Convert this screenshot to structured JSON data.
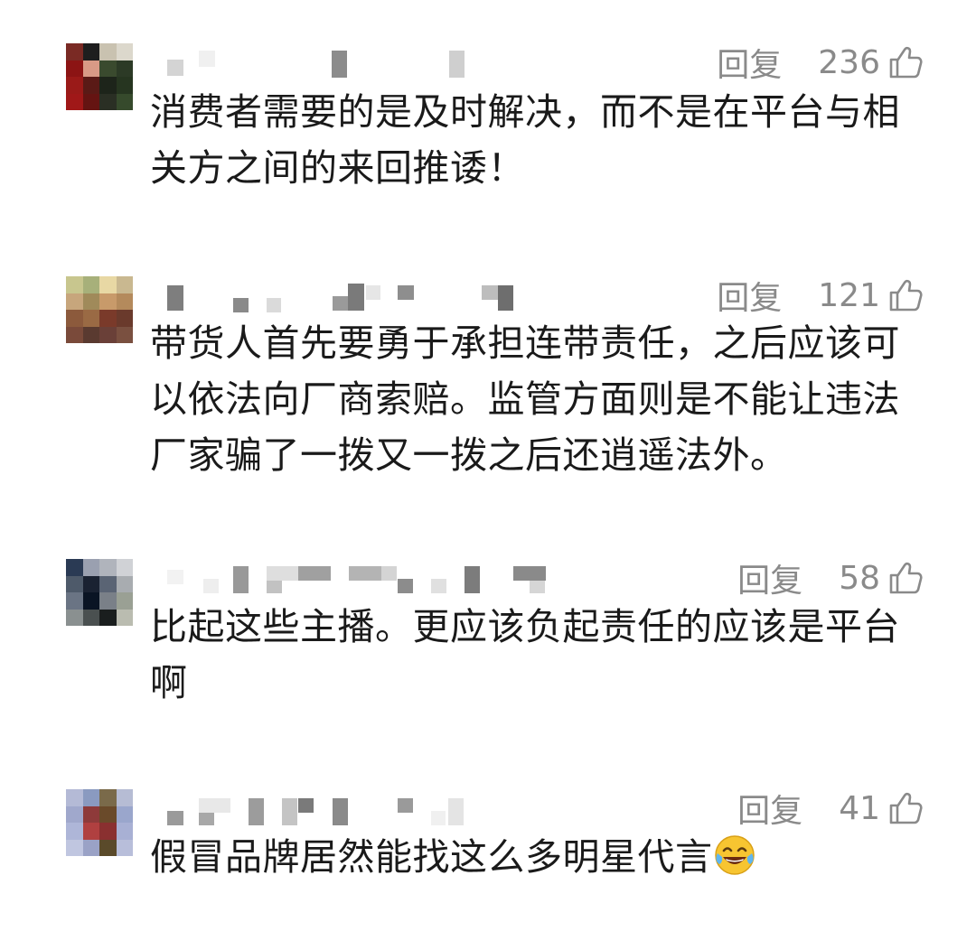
{
  "comments": [
    {
      "reply_label": "回复",
      "likes": "236",
      "text": "消费者需要的是及时解决，而不是在平台与相关方之间的来回推诿！",
      "avatar_icon": "pixelated-avatar-icon",
      "like_icon": "thumb-up-icon"
    },
    {
      "reply_label": "回复",
      "likes": "121",
      "text": "带货人首先要勇于承担连带责任，之后应该可以依法向厂商索赔。监管方面则是不能让违法厂家骗了一拨又一拨之后还逍遥法外。",
      "avatar_icon": "pixelated-avatar-icon",
      "like_icon": "thumb-up-icon"
    },
    {
      "reply_label": "回复",
      "likes": "58",
      "text": "比起这些主播。更应该负起责任的应该是平台啊",
      "avatar_icon": "pixelated-avatar-icon",
      "like_icon": "thumb-up-icon"
    },
    {
      "reply_label": "回复",
      "likes": "41",
      "text": "假冒品牌居然能找这么多明星代言",
      "emoji_icon": "laughing-tears-emoji-icon",
      "avatar_icon": "pixelated-avatar-icon",
      "like_icon": "thumb-up-icon"
    }
  ],
  "colors": {
    "meta_gray": "#8a8a8a",
    "text": "#1a1a1a"
  }
}
